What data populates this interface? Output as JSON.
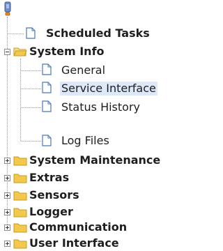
{
  "tree": {
    "root_icon": "computer-icon",
    "items": [
      {
        "label": "Scheduled Tasks",
        "type": "page",
        "level": 1,
        "bold": true
      },
      {
        "label": "System Info",
        "type": "folder",
        "level": 1,
        "state": "expanded",
        "bold": true
      },
      {
        "label": "General",
        "type": "page",
        "level": 2,
        "bold": false
      },
      {
        "label": "Service Interface",
        "type": "page",
        "level": 2,
        "bold": false,
        "selected": true
      },
      {
        "label": "Status History",
        "type": "page",
        "level": 2,
        "bold": false
      },
      {
        "label": "Log Files",
        "type": "page",
        "level": 2,
        "bold": false
      },
      {
        "label": "System Maintenance",
        "type": "folder",
        "level": 1,
        "state": "collapsed",
        "bold": true
      },
      {
        "label": "Extras",
        "type": "folder",
        "level": 1,
        "state": "collapsed",
        "bold": true
      },
      {
        "label": "Sensors",
        "type": "folder",
        "level": 1,
        "state": "collapsed",
        "bold": true
      },
      {
        "label": "Logger",
        "type": "folder",
        "level": 1,
        "state": "collapsed",
        "bold": true
      },
      {
        "label": "Communication",
        "type": "folder",
        "level": 1,
        "state": "collapsed",
        "bold": true
      },
      {
        "label": "User Interface",
        "type": "folder",
        "level": 1,
        "state": "collapsed",
        "bold": true
      }
    ]
  },
  "colors": {
    "folder": "#f2c94c",
    "selection": "#dde8f8",
    "text": "#1e1e1e",
    "page_border": "#4a78b8"
  }
}
